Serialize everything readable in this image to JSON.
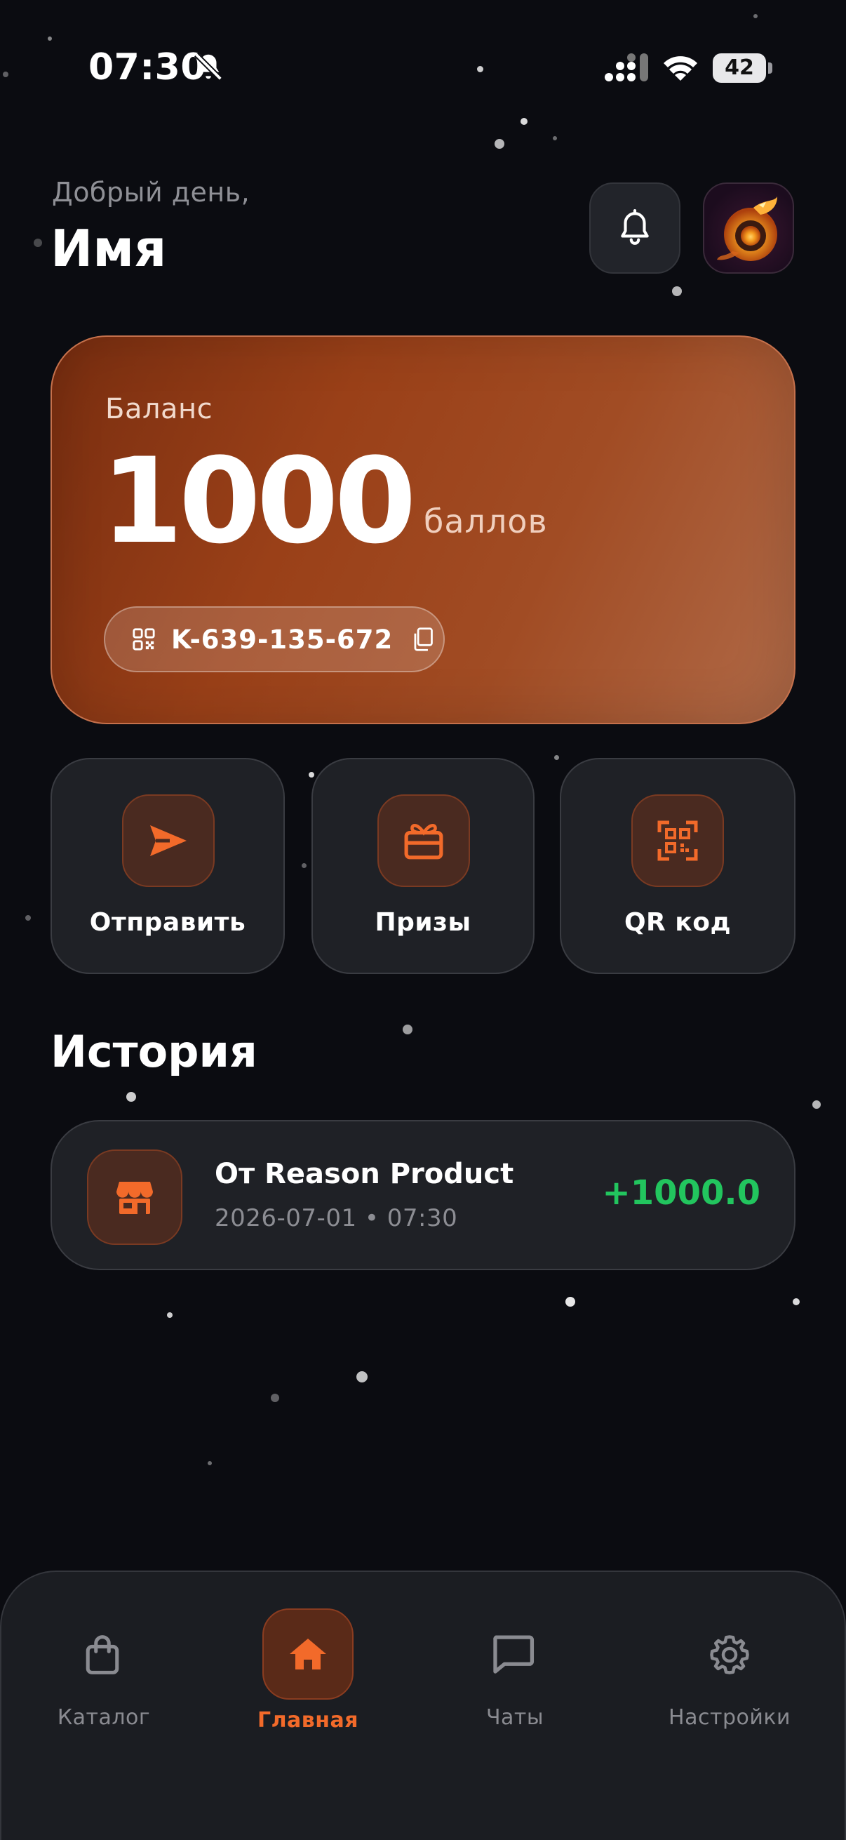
{
  "status_bar": {
    "time": "07:30",
    "battery_level": "42",
    "icons": [
      "bell-slash-icon",
      "cellular-signal-icon",
      "wifi-icon",
      "battery-icon"
    ]
  },
  "header": {
    "greeting": "Добрый день,",
    "name": "Имя",
    "icons": [
      "bell-icon",
      "avatar"
    ]
  },
  "balance": {
    "label": "Баланс",
    "value": "1000",
    "unit": "баллов",
    "account_id": "K-639-135-672",
    "icons": [
      "qr-mini-icon",
      "copy-icon"
    ]
  },
  "actions": [
    {
      "label": "Отправить",
      "icon": "send-icon"
    },
    {
      "label": "Призы",
      "icon": "gift-icon"
    },
    {
      "label": "QR код",
      "icon": "qr-scan-icon"
    }
  ],
  "history": {
    "title": "История",
    "items": [
      {
        "sender": "От Reason Product",
        "date": "2026-07-01",
        "time": "07:30",
        "amount": "+1000.0",
        "icon": "store-icon"
      }
    ]
  },
  "bottom_nav": {
    "items": [
      {
        "label": "Каталог",
        "icon": "shopping-bag-icon",
        "active": false
      },
      {
        "label": "Главная",
        "icon": "home-icon",
        "active": true
      },
      {
        "label": "Чаты",
        "icon": "chat-icon",
        "active": false
      },
      {
        "label": "Настройки",
        "icon": "gear-icon",
        "active": false
      }
    ]
  },
  "colors": {
    "background": "#0b0c11",
    "accent": "#f26a2a",
    "card": "#1f2126",
    "positive": "#22c55e",
    "balance_card": "#9a4018"
  }
}
